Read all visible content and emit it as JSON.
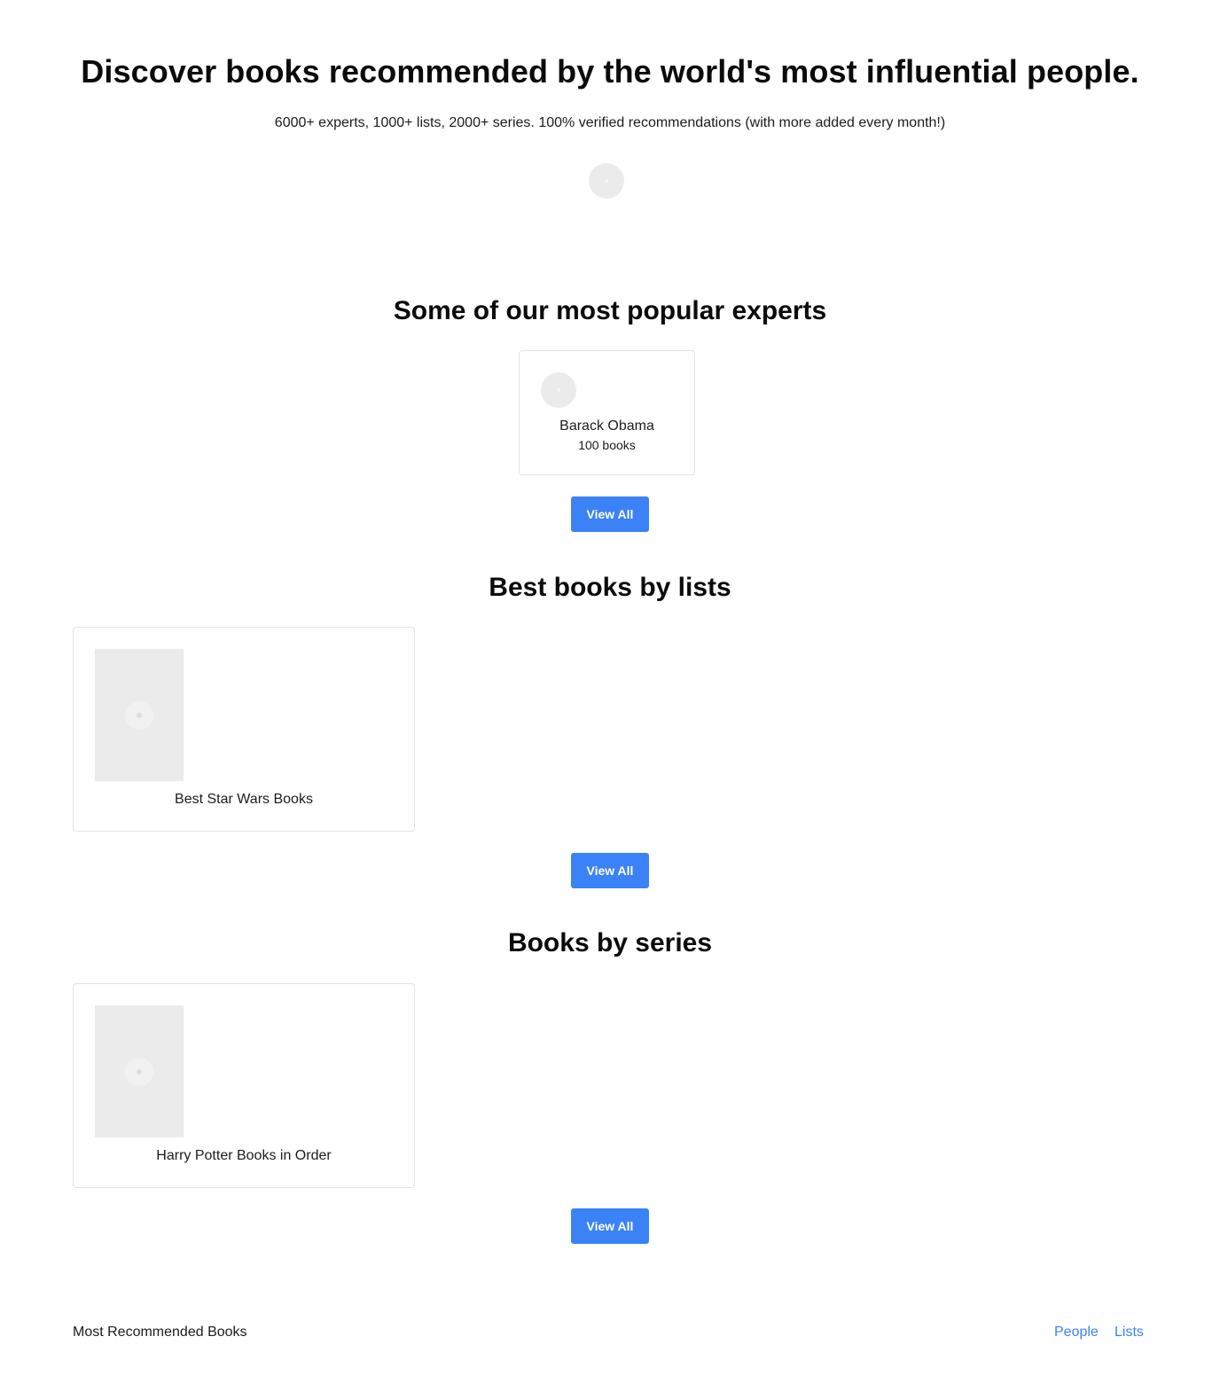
{
  "hero": {
    "title": "Discover books recommended by the world's most influential people.",
    "subtitle": "6000+ experts, 1000+ lists, 2000+ series. 100% verified recommendations (with more added every month!)"
  },
  "experts": {
    "heading": "Some of our most popular experts",
    "items": [
      {
        "name": "Barack Obama",
        "count": "100 books"
      }
    ],
    "view_all_label": "View All"
  },
  "lists": {
    "heading": "Best books by lists",
    "items": [
      {
        "title": "Best Star Wars Books"
      }
    ],
    "view_all_label": "View All"
  },
  "series": {
    "heading": "Books by series",
    "items": [
      {
        "title": "Harry Potter Books in Order"
      }
    ],
    "view_all_label": "View All"
  },
  "footer": {
    "brand": "Most Recommended Books",
    "links": [
      "People",
      "Lists"
    ]
  },
  "colors": {
    "accent": "#3b82f6",
    "placeholder": "#ebebeb",
    "card_border": "#e3e3e3"
  }
}
